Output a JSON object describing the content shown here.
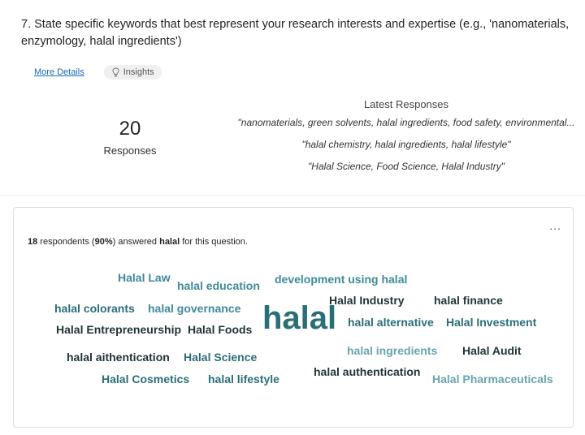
{
  "question": {
    "text": "7. State specific keywords that best represent your research interests and expertise (e.g., 'nanomaterials, enzymology, halal ingredients')"
  },
  "links": {
    "more_details": "More Details",
    "insights": "Insights"
  },
  "summary": {
    "count": "20",
    "count_label": "Responses",
    "latest_title": "Latest Responses",
    "latest": [
      "\"nanomaterials, green solvents, halal ingredients, food safety, environmental...",
      "\"halal chemistry, halal ingredients, halal lifestyle\"",
      "\"Halal Science, Food Science, Halal Industry\""
    ]
  },
  "word_cloud_card": {
    "menu": "...",
    "respondents": "18",
    "respondents_suffix": " respondents (",
    "percent": "90%",
    "answered_text": ") answered ",
    "keyword": "halal",
    "tail": " for this question.",
    "words": [
      {
        "text": "Halal Law",
        "tone": "teal"
      },
      {
        "text": "halal education",
        "tone": "teal"
      },
      {
        "text": "development using halal",
        "tone": "teal"
      },
      {
        "text": "Halal Industry",
        "tone": "dark"
      },
      {
        "text": "halal finance",
        "tone": "dark"
      },
      {
        "text": "halal colorants",
        "tone": "green"
      },
      {
        "text": "halal governance",
        "tone": "teal"
      },
      {
        "text": "halal",
        "tone": "green"
      },
      {
        "text": "halal alternative",
        "tone": "green"
      },
      {
        "text": "Halal Investment",
        "tone": "green"
      },
      {
        "text": "Halal Entrepreneurship",
        "tone": "dark"
      },
      {
        "text": "Halal Foods",
        "tone": "dark"
      },
      {
        "text": "halal aithentication",
        "tone": "dark"
      },
      {
        "text": "Halal Science",
        "tone": "green"
      },
      {
        "text": "halal ingredients",
        "tone": "light"
      },
      {
        "text": "Halal Audit",
        "tone": "dark"
      },
      {
        "text": "Halal Cosmetics",
        "tone": "green"
      },
      {
        "text": "halal lifestyle",
        "tone": "green"
      },
      {
        "text": "halal authentication",
        "tone": "dark"
      },
      {
        "text": "Halal Pharmaceuticals",
        "tone": "light"
      }
    ]
  },
  "colors": {
    "teal": "#3d8a9a",
    "light": "#6aa4b0",
    "dark": "#1f3337",
    "green": "#2a6e78",
    "link": "#1a6bb5"
  },
  "icons": {
    "insights": "lightbulb-icon",
    "menu": "more-dots-icon"
  }
}
